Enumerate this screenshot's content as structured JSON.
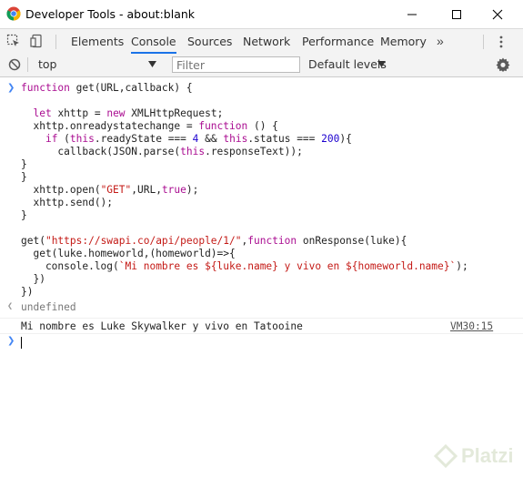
{
  "window": {
    "title": "Developer Tools - about:blank"
  },
  "tabs": [
    {
      "label": "Elements",
      "active": false
    },
    {
      "label": "Console",
      "active": true
    },
    {
      "label": "Sources",
      "active": false
    },
    {
      "label": "Network",
      "active": false
    },
    {
      "label": "Performance",
      "active": false
    },
    {
      "label": "Memory",
      "active": false
    }
  ],
  "tabs_overflow": "»",
  "filterbar": {
    "context": "top",
    "filter_placeholder": "Filter",
    "levels": "Default levels"
  },
  "console": {
    "code_lines": [
      "function get(URL,callback) {",
      "",
      "  let xhttp = new XMLHttpRequest;",
      "  xhttp.onreadystatechange = function () {",
      "    if (this.readyState === 4 && this.status === 200){",
      "      callback(JSON.parse(this.responseText));",
      "}",
      "}",
      "  xhttp.open(\"GET\",URL,true);",
      "  xhttp.send();",
      "}",
      "",
      "get(\"https://swapi.co/api/people/1/\",function onResponse(luke){",
      "  get(luke.homeworld,(homeworld)=>{",
      "    console.log(`Mi nombre es ${luke.name} y vivo en ${homeworld.name}`);",
      "  })",
      "})"
    ],
    "result": "undefined",
    "log_message": "Mi nombre es Luke Skywalker y vivo en Tatooine",
    "log_source": "VM30:15"
  },
  "watermark": "Platzi",
  "colors": {
    "keyword": "#aa0d91",
    "string": "#c41a16",
    "number": "#1c00cf",
    "active_tab": "#1a73e8"
  }
}
